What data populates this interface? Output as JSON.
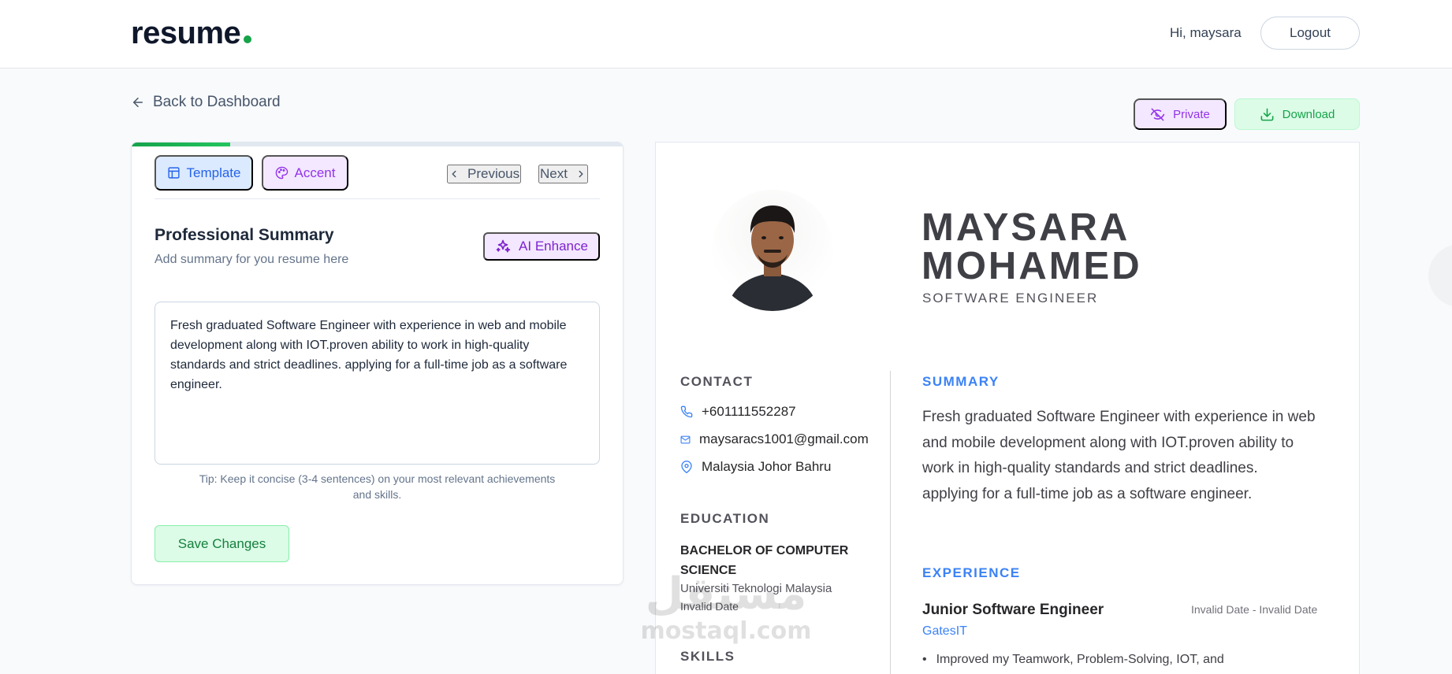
{
  "nav": {
    "logo_text": "resume",
    "greeting": "Hi, maysara",
    "logout_label": "Logout"
  },
  "back_link_label": "Back to Dashboard",
  "actions": {
    "private_label": "Private",
    "download_label": "Download"
  },
  "editor": {
    "progress_percent": 20,
    "tabs": {
      "template_label": "Template",
      "accent_label": "Accent"
    },
    "nav": {
      "previous_label": "Previous",
      "next_label": "Next"
    },
    "section_title": "Professional Summary",
    "section_subtitle": "Add summary for you resume here",
    "ai_enhance_label": "AI Enhance",
    "summary_value": "Fresh graduated Software Engineer with experience in web and mobile development along with IOT.proven ability to work in high-quality standards and strict deadlines. applying for a full-time job as a software engineer.",
    "tip": "Tip: Keep it concise (3-4 sentences) on your most relevant achievements and skills.",
    "save_label": "Save Changes"
  },
  "resume": {
    "name_line1": "MAYSARA",
    "name_line2": "MOHAMED",
    "title": "SOFTWARE ENGINEER",
    "contact_heading": "CONTACT",
    "phone": "+601111552287",
    "email": "maysaracs1001@gmail.com",
    "location": "Malaysia Johor Bahru",
    "education_heading": "EDUCATION",
    "degree": "BACHELOR OF COMPUTER SCIENCE",
    "university": "Universiti Teknologi Malaysia",
    "education_date": "Invalid Date",
    "skills_heading": "SKILLS",
    "summary_heading": "SUMMARY",
    "summary": "Fresh graduated Software Engineer with experience in web and mobile development along with IOT.proven ability to work in high-quality standards and strict deadlines. applying for a full-time job as a software engineer.",
    "experience_heading": "EXPERIENCE",
    "experience": [
      {
        "role": "Junior Software Engineer",
        "date": "Invalid Date - Invalid Date",
        "company": "GatesIT",
        "bullet": "Improved my Teamwork, Problem-Solving, IOT, and"
      }
    ]
  },
  "watermark": {
    "arabic": "مستقل",
    "latin": "mostaql.com"
  },
  "colors": {
    "brand_green": "#16a34a",
    "accent_blue": "#3b82f6",
    "purple": "#9333ea"
  }
}
